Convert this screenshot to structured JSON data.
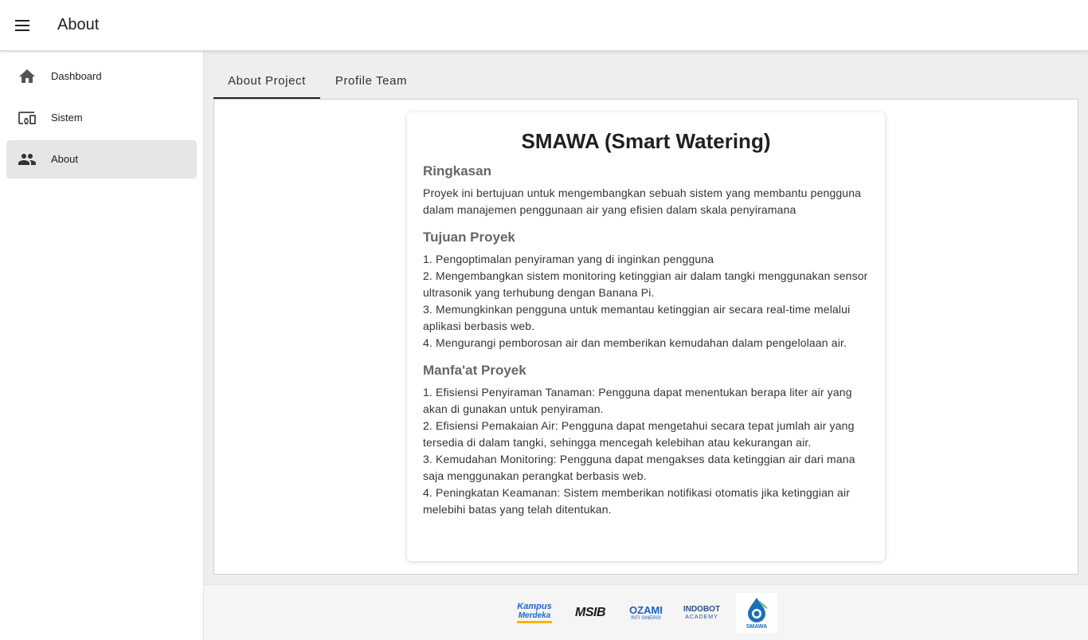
{
  "appbar": {
    "title": "About",
    "menu_icon": "menu-icon"
  },
  "sidebar": {
    "items": [
      {
        "label": "Dashboard",
        "icon": "home-icon",
        "active": false
      },
      {
        "label": "Sistem",
        "icon": "devices-icon",
        "active": false
      },
      {
        "label": "About",
        "icon": "people-icon",
        "active": true
      }
    ]
  },
  "tabs": [
    {
      "label": "About Project",
      "active": true
    },
    {
      "label": "Profile Team",
      "active": false
    }
  ],
  "card": {
    "title": "SMAWA (Smart Watering)",
    "ringkasan": {
      "heading": "Ringkasan",
      "text": "Proyek ini bertujuan untuk mengembangkan sebuah sistem yang membantu pengguna dalam manajemen penggunaan air yang efisien dalam skala penyiramana"
    },
    "tujuan": {
      "heading": "Tujuan Proyek",
      "items": [
        "1. Pengoptimalan penyiraman yang di inginkan pengguna",
        "2. Mengembangkan sistem monitoring ketinggian air dalam tangki menggunakan sensor ultrasonik yang terhubung dengan Banana Pi.",
        "3. Memungkinkan pengguna untuk memantau ketinggian air secara real-time melalui aplikasi berbasis web.",
        "4. Mengurangi pemborosan air dan memberikan kemudahan dalam pengelolaan air."
      ]
    },
    "manfaat": {
      "heading": "Manfa'at Proyek",
      "items": [
        "1. Efisiensi Penyiraman Tanaman: Pengguna dapat menentukan berapa liter air yang akan di gunakan untuk penyiraman.",
        "2. Efisiensi Pemakaian Air: Pengguna dapat mengetahui secara tepat jumlah air yang tersedia di dalam tangki, sehingga mencegah kelebihan atau kekurangan air.",
        "3. Kemudahan Monitoring: Pengguna dapat mengakses data ketinggian air dari mana saja menggunakan perangkat berbasis web.",
        "4. Peningkatan Keamanan: Sistem memberikan notifikasi otomatis jika ketinggian air melebihi batas yang telah ditentukan."
      ]
    }
  },
  "footer": {
    "logos": [
      {
        "text": "Kampus",
        "text2": "Merdeka",
        "color": "#1e66c8"
      },
      {
        "text": "MSIB",
        "color": "#1a1a1a"
      },
      {
        "text": "OZAMI",
        "text2": "INTI SINERGI",
        "color": "#1f5fbf"
      },
      {
        "text": "INDOBOT",
        "text2": "ACADEMY",
        "color": "#2a4f8f"
      },
      {
        "text": "SMAWA",
        "color": "#1c6fb5"
      }
    ]
  },
  "colors": {
    "active_bg": "#e6e6e6",
    "main_bg": "#eeeeee",
    "accent": "#212121"
  }
}
